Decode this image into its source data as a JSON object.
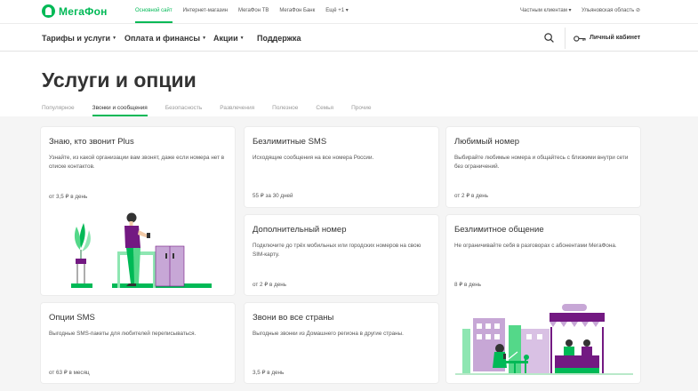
{
  "brand": {
    "name": "МегаФон",
    "color": "#00b956",
    "accent_purple": "#731982"
  },
  "topbar": {
    "links": [
      {
        "label": "Основной сайт",
        "active": true
      },
      {
        "label": "Интернет-магазин",
        "active": false
      },
      {
        "label": "МегаФон ТВ",
        "active": false
      },
      {
        "label": "МегаФон Банк",
        "active": false
      },
      {
        "label": "Ещё +1 ▾",
        "active": false
      }
    ],
    "segment": "Частным клиентам ▾",
    "region": "Ульяновская область ⊘"
  },
  "nav": {
    "items": [
      {
        "label": "Тарифы и услуги",
        "has_menu": true
      },
      {
        "label": "Оплата и финансы",
        "has_menu": true
      },
      {
        "label": "Акции",
        "has_menu": true
      },
      {
        "label": "Поддержка",
        "has_menu": false
      }
    ],
    "caret": "▼",
    "search_icon": "search-icon",
    "account_label": "Личный кабинет",
    "account_icon": "key-icon"
  },
  "page": {
    "title": "Услуги и опции",
    "tabs": [
      {
        "label": "Популярное",
        "active": false
      },
      {
        "label": "Звонки и сообщения",
        "active": true
      },
      {
        "label": "Безопасность",
        "active": false
      },
      {
        "label": "Развлечения",
        "active": false
      },
      {
        "label": "Полезное",
        "active": false
      },
      {
        "label": "Семья",
        "active": false
      },
      {
        "label": "Прочие",
        "active": false
      }
    ]
  },
  "cards": {
    "who_calls": {
      "title": "Знаю, кто звонит Plus",
      "desc": "Узнайте, из какой организации вам звонят, даже если номера нет в списке контактов.",
      "price": "от 3,5 ₽ в день"
    },
    "unlimited_sms": {
      "title": "Безлимитные SMS",
      "desc": "Исходящие сообщения на все номера России.",
      "price": "55 ₽ за 30 дней"
    },
    "favorite_number": {
      "title": "Любимый номер",
      "desc": "Выбирайте любимые номера и общайтесь с близкими внутри сети без ограничений.",
      "price": "от 2 ₽ в день"
    },
    "extra_number": {
      "title": "Дополнительный номер",
      "desc": "Подключите до трёх мобильных или городских номеров на свою SIM-карту.",
      "price": "от 2 ₽ в день"
    },
    "unlimited_talk": {
      "title": "Безлимитное общение",
      "desc": "Не ограничивайте себя в разговорах с абонентами МегаФона.",
      "price": "8 ₽ в день"
    },
    "sms_options": {
      "title": "Опции SMS",
      "desc": "Выгодные SMS-пакеты для любителей переписываться.",
      "price": "от 63 ₽ в месяц"
    },
    "world_calls": {
      "title": "Звони во все страны",
      "desc": "Выгодные звонки из Домашнего региона в другие страны.",
      "price": "3,5 ₽ в день"
    }
  }
}
